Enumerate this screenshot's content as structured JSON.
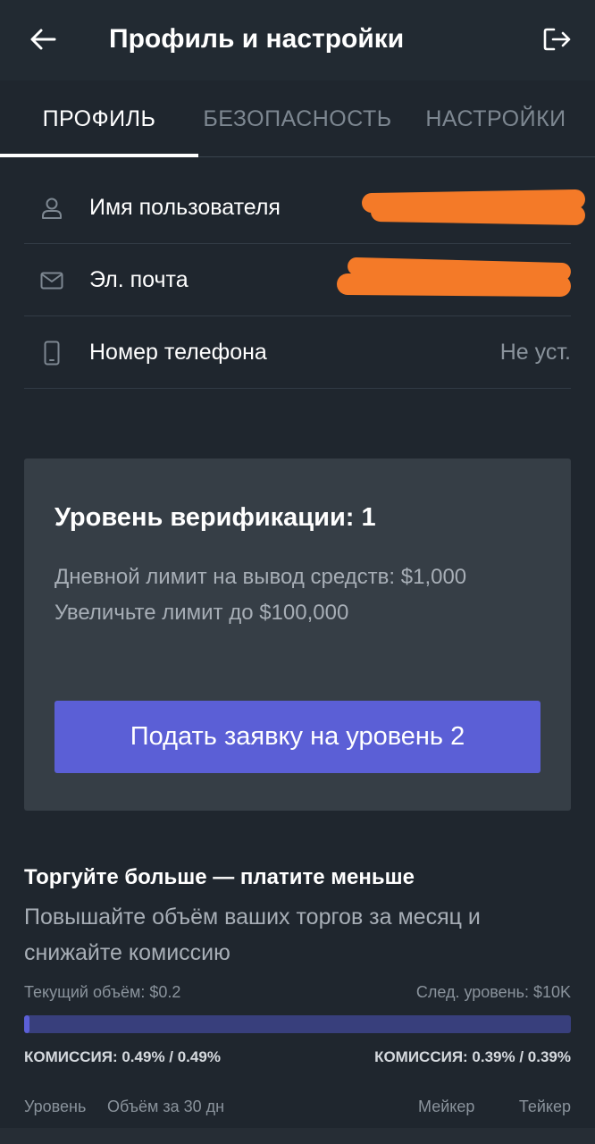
{
  "header": {
    "title": "Профиль и настройки",
    "back_icon": "arrow-left-icon",
    "logout_icon": "logout-icon"
  },
  "tabs": [
    {
      "label": "ПРОФИЛЬ",
      "active": true
    },
    {
      "label": "БЕЗОПАСНОСТЬ",
      "active": false
    },
    {
      "label": "НАСТРОЙКИ",
      "active": false
    }
  ],
  "profile": {
    "username": {
      "label": "Имя пользователя",
      "icon": "user-icon"
    },
    "email": {
      "label": "Эл. почта",
      "icon": "mail-icon"
    },
    "phone": {
      "label": "Номер телефона",
      "icon": "phone-icon",
      "value": "Не уст."
    }
  },
  "verification": {
    "title": "Уровень верификации: 1",
    "daily_limit": "Дневной лимит на вывод средств: $1,000",
    "increase_limit": "Увеличьте лимит до $100,000",
    "button_label": "Подать заявку на уровень 2"
  },
  "promo": {
    "title": "Торгуйте больше — платите меньше",
    "subtitle": "Повышайте объём ваших торгов за месяц и снижайте комиссию",
    "current_volume": "Текущий объём: $0.2",
    "next_level": "След. уровень: $10K",
    "progress_fraction": 0.01,
    "current_fee": "КОМИССИЯ: 0.49% / 0.49%",
    "next_fee": "КОМИССИЯ: 0.39% / 0.39%"
  },
  "table_headers": [
    "Уровень",
    "Объём за 30 дн",
    "Мейкер",
    "Тейкер"
  ],
  "colors": {
    "background": "#1f262e",
    "accent": "#5b5fd6",
    "redaction": "#f47a28"
  }
}
